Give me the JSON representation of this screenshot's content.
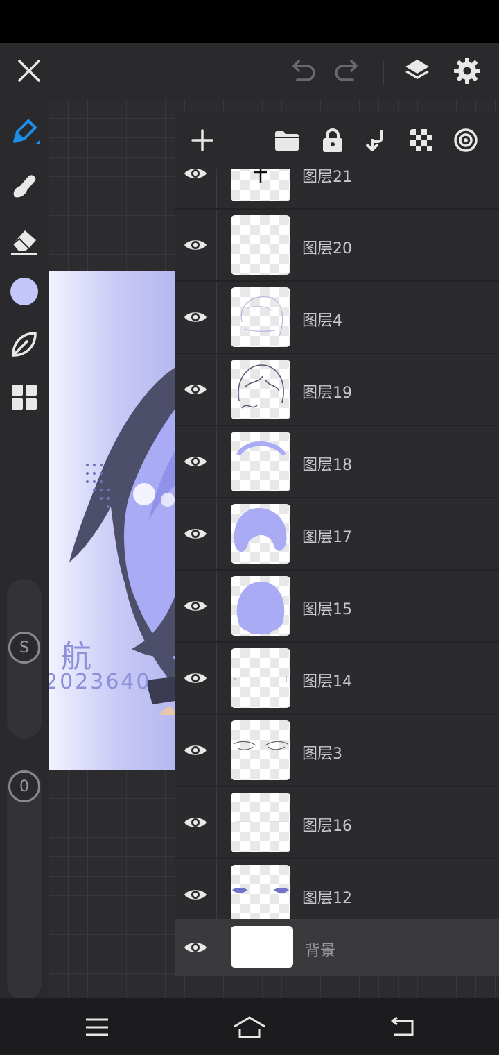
{
  "toolbar": {
    "close": "close-icon",
    "undo": "undo-icon",
    "redo": "redo-icon",
    "layers": "layers-icon",
    "settings": "gear-icon"
  },
  "tools": {
    "brush_color": "#1e8fe8",
    "current_color": "#c3c6fb",
    "size_label": "S",
    "opacity_label": "0"
  },
  "artwork": {
    "signature_char": "航",
    "signature_number": "2023640"
  },
  "layers": [
    {
      "name": "图层21",
      "visible": true
    },
    {
      "name": "图层20",
      "visible": true
    },
    {
      "name": "图层4",
      "visible": true
    },
    {
      "name": "图层19",
      "visible": true
    },
    {
      "name": "图层18",
      "visible": true
    },
    {
      "name": "图层17",
      "visible": true
    },
    {
      "name": "图层15",
      "visible": true
    },
    {
      "name": "图层14",
      "visible": true
    },
    {
      "name": "图层3",
      "visible": true
    },
    {
      "name": "图层16",
      "visible": true
    },
    {
      "name": "图层12",
      "visible": true
    },
    {
      "name": "背景",
      "visible": true,
      "selected": true
    }
  ],
  "colors": {
    "panel": "#232326",
    "row": "#2b2b2e",
    "selected_row": "#3a3a3d",
    "accent_blue": "#1e8fe8",
    "hair_lavender": "#a9abf5"
  }
}
